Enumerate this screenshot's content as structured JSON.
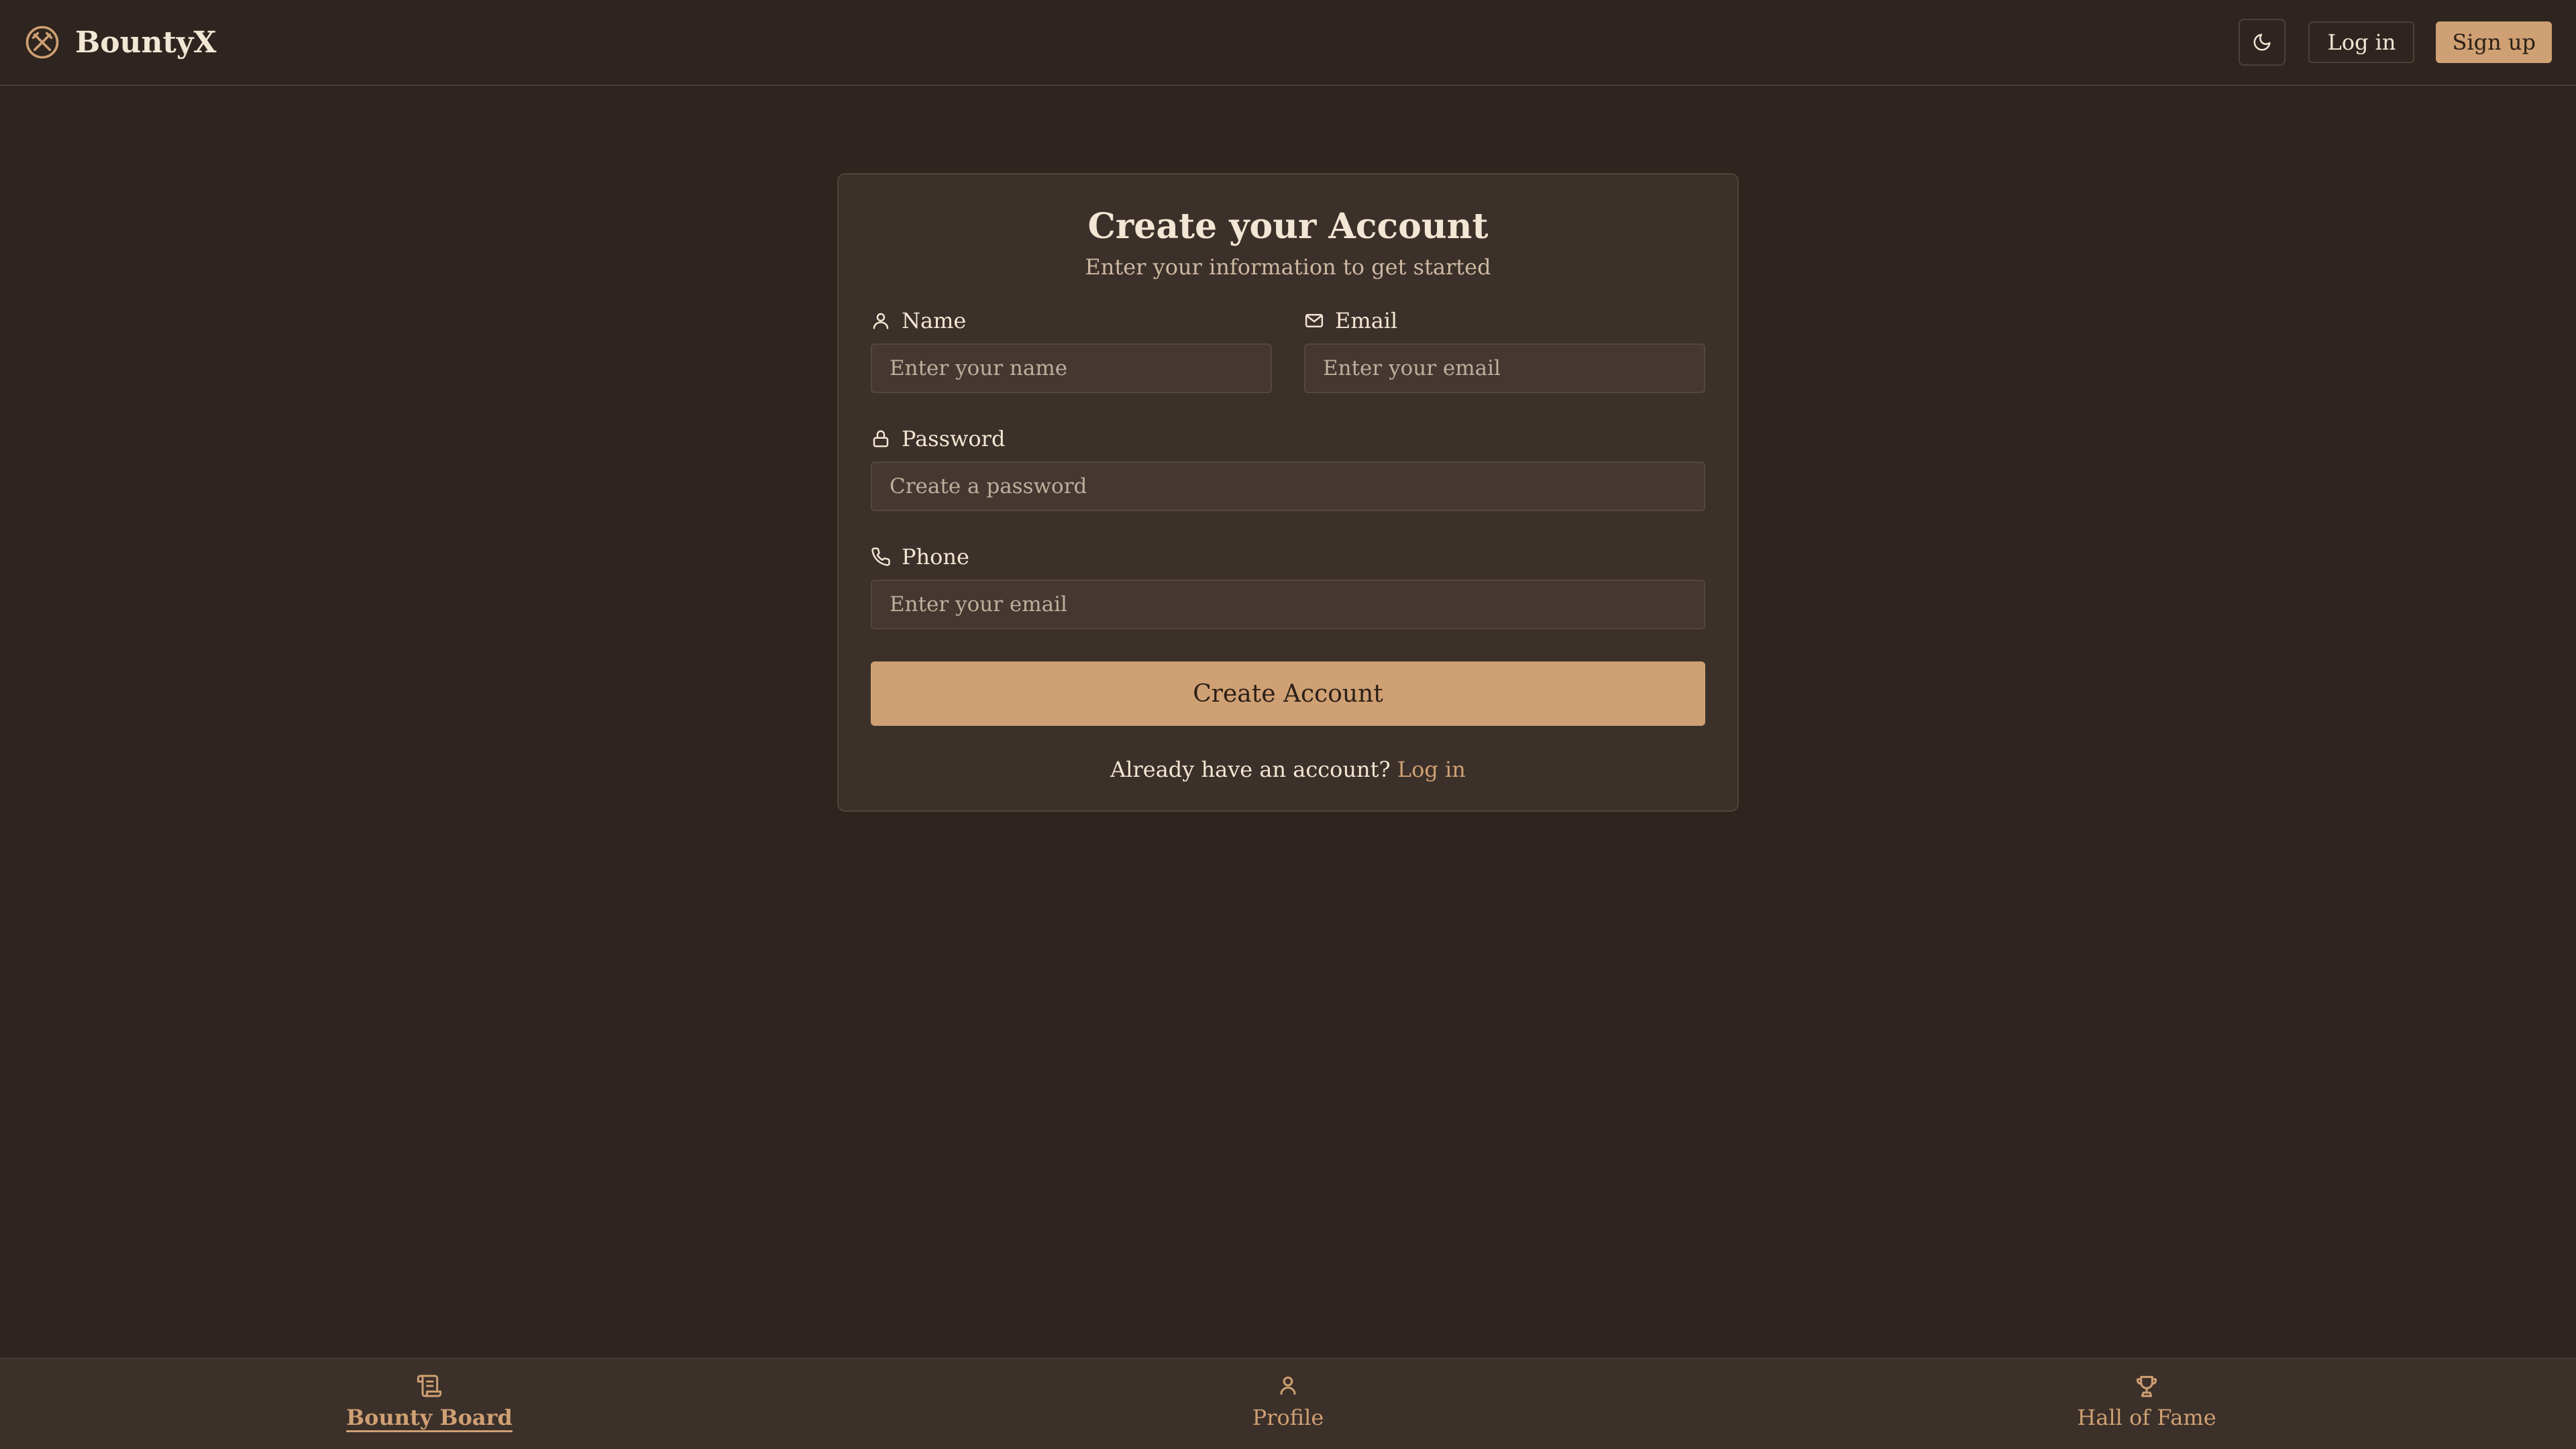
{
  "app": {
    "brand_name": "BountyX",
    "brand_icon": "crossed-swords-icon",
    "accent_color": "#cfa073",
    "background_color": "#2f2520"
  },
  "header": {
    "theme_toggle_icon": "moon-icon",
    "login_label": "Log in",
    "signup_label": "Sign up"
  },
  "form": {
    "title": "Create your Account",
    "subtitle": "Enter your information to get started",
    "name": {
      "label": "Name",
      "icon": "user-icon",
      "placeholder": "Enter your name",
      "value": ""
    },
    "email": {
      "label": "Email",
      "icon": "mail-icon",
      "placeholder": "Enter your email",
      "value": ""
    },
    "password": {
      "label": "Password",
      "icon": "lock-icon",
      "placeholder": "Create a password",
      "value": ""
    },
    "phone": {
      "label": "Phone",
      "icon": "phone-icon",
      "placeholder": "Enter your email",
      "value": ""
    },
    "submit_label": "Create Account",
    "footer_text": "Already have an account?",
    "footer_link": "Log in"
  },
  "bottom_nav": {
    "items": [
      {
        "label": "Bounty Board",
        "icon": "scroll-icon",
        "active": true
      },
      {
        "label": "Profile",
        "icon": "user-icon",
        "active": false
      },
      {
        "label": "Hall of Fame",
        "icon": "trophy-icon",
        "active": false
      }
    ]
  }
}
